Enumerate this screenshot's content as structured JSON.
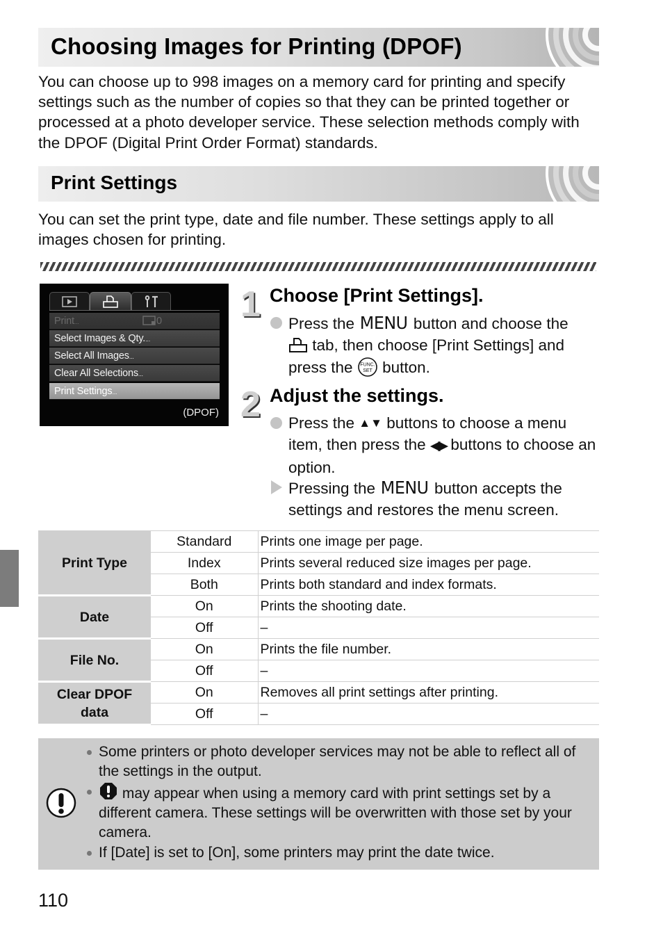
{
  "page": {
    "title": "Choosing Images for Printing (DPOF)",
    "intro": "You can choose up to 998 images on a memory card for printing and specify settings such as the number of copies so that they can be printed together or processed at a photo developer service. These selection methods comply with the DPOF (Digital Print Order Format) standards.",
    "section_title": "Print Settings",
    "section_intro": "You can set the print type, date and file number. These settings apply to all images chosen for printing.",
    "page_number": "110"
  },
  "camera_screen": {
    "tabs": [
      {
        "icon": "playback-icon",
        "active": false
      },
      {
        "icon": "print-icon",
        "active": true
      },
      {
        "icon": "tools-icon",
        "active": false
      }
    ],
    "menu_items": [
      {
        "label": "Print",
        "state": "disabled",
        "count": "0"
      },
      {
        "label": "Select Images & Qty.",
        "state": "normal"
      },
      {
        "label": "Select All Images",
        "state": "normal"
      },
      {
        "label": "Clear All Selections",
        "state": "normal"
      },
      {
        "label": "Print Settings",
        "state": "selected"
      }
    ],
    "ellipsis": "...",
    "footer_label": "(DPOF)"
  },
  "steps": [
    {
      "number": "1",
      "title": "Choose [Print Settings].",
      "bullets": [
        {
          "type": "dot",
          "parts": {
            "a": "Press the ",
            "menu": "MENU",
            "b": " button and choose the ",
            "c": " tab, then choose [Print Settings] and press the ",
            "d": " button."
          }
        }
      ]
    },
    {
      "number": "2",
      "title": "Adjust the settings.",
      "bullets": [
        {
          "type": "dot",
          "parts": {
            "a": "Press the ",
            "updown": "▲▼",
            "b": " buttons to choose a menu item, then press the ",
            "leftright": "◀▶",
            "c": " buttons to choose an option."
          }
        },
        {
          "type": "arrow",
          "parts": {
            "a": "Pressing the ",
            "menu": "MENU",
            "b": " button accepts the settings and restores the menu screen."
          }
        }
      ]
    }
  ],
  "settings_table": {
    "groups": [
      {
        "name": "Print Type",
        "rows": [
          {
            "option": "Standard",
            "description": "Prints one image per page."
          },
          {
            "option": "Index",
            "description": "Prints several reduced size images per page."
          },
          {
            "option": "Both",
            "description": "Prints both standard and index formats."
          }
        ]
      },
      {
        "name": "Date",
        "rows": [
          {
            "option": "On",
            "description": "Prints the shooting date."
          },
          {
            "option": "Off",
            "description": "–"
          }
        ]
      },
      {
        "name": "File No.",
        "rows": [
          {
            "option": "On",
            "description": "Prints the file number."
          },
          {
            "option": "Off",
            "description": "–"
          }
        ]
      },
      {
        "name": "Clear DPOF data",
        "name_lines": [
          "Clear DPOF",
          "data"
        ],
        "rows": [
          {
            "option": "On",
            "description": "Removes all print settings after printing."
          },
          {
            "option": "Off",
            "description": "–"
          }
        ]
      }
    ]
  },
  "caution": {
    "icon": "caution-icon",
    "items": [
      {
        "text": "Some printers or photo developer services may not be able to reflect all of the settings in the output."
      },
      {
        "icon": "warning-octagon-icon",
        "text": " may appear when using a memory card with print settings set by a different camera. These settings will be overwritten with those set by your camera."
      },
      {
        "text": "If [Date] is set to [On], some printers may print the date twice."
      }
    ]
  },
  "colors": {
    "header_gradient_start": "#efefef",
    "header_gradient_end": "#b4b4b4",
    "table_header_bg": "#cfcfcf",
    "caution_bg": "#cccccc",
    "side_tab": "#7c7c7c",
    "bullet_gray": "#c4c4c4"
  }
}
